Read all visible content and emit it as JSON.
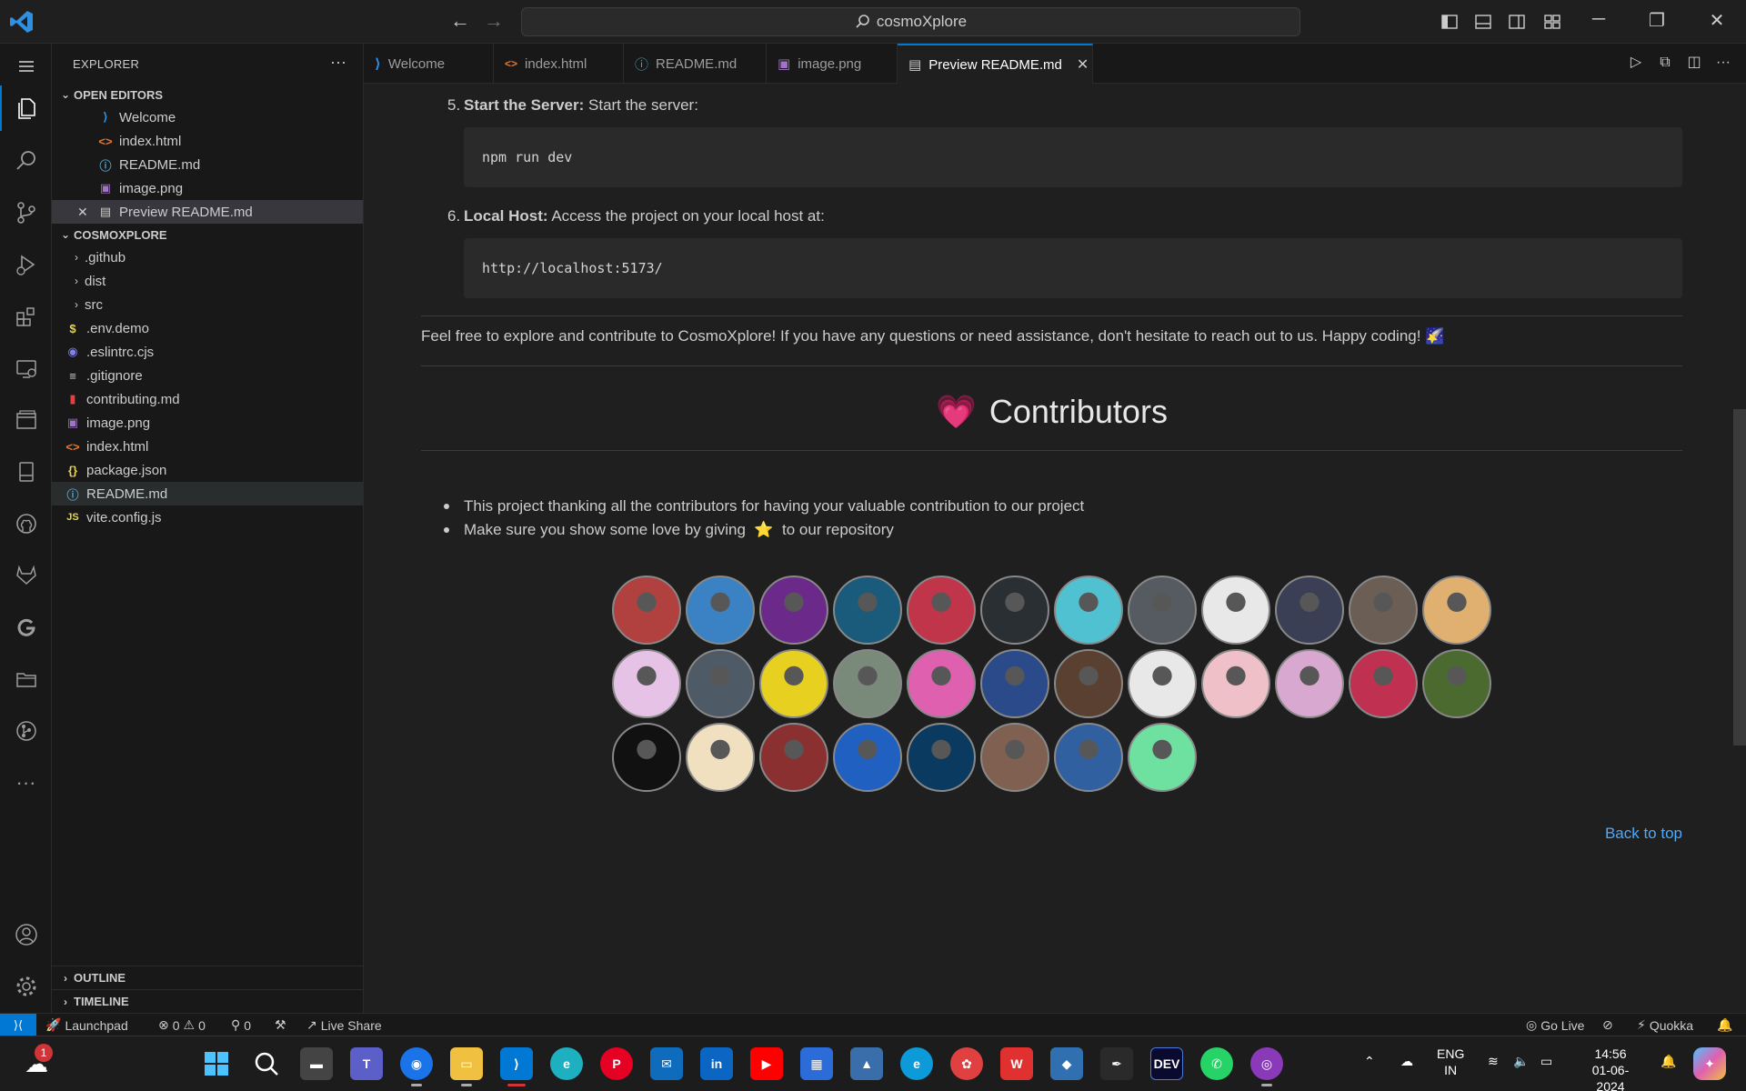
{
  "titlebar": {
    "search_text": "cosmoXplore"
  },
  "sidebar": {
    "title": "EXPLORER",
    "open_editors_title": "OPEN EDITORS",
    "open_editors": [
      "Welcome",
      "index.html",
      "README.md",
      "image.png",
      "Preview README.md"
    ],
    "project_title": "COSMOXPLORE",
    "files": [
      ".github",
      "dist",
      "src",
      ".env.demo",
      ".eslintrc.cjs",
      ".gitignore",
      "contributing.md",
      "image.png",
      "index.html",
      "package.json",
      "README.md",
      "vite.config.js"
    ],
    "outline_label": "OUTLINE",
    "timeline_label": "TIMELINE"
  },
  "tabs": [
    "Welcome",
    "index.html",
    "README.md",
    "image.png",
    "Preview README.md"
  ],
  "content": {
    "step5_num": "5.",
    "step5_bold": "Start the Server:",
    "step5_text": " Start the server:",
    "step5_code": "npm run dev",
    "step6_num": "6.",
    "step6_bold": "Local Host:",
    "step6_text": " Access the project on your local host at:",
    "step6_code": "http://localhost:5173/",
    "outro": "Feel free to explore and contribute to CosmoXplore! If you have any questions or need assistance, don't hesitate to reach out to us. Happy coding! 🌠",
    "contributors_heading": "Contributors",
    "heart": "💗",
    "bullet1": "This project thanking all the contributors for having your valuable contribution to our project",
    "bullet2_a": "Make sure you show some love by giving",
    "bullet2_star": "⭐",
    "bullet2_b": "to our repository",
    "back_to_top": "Back to top",
    "avatar_colors": [
      "#b0413e",
      "#3b82c4",
      "#6b2a8a",
      "#1a5a7a",
      "#c0354a",
      "#2a2f33",
      "#4fc1d0",
      "#555b60",
      "#e8e8e8",
      "#3a3f55",
      "#6b5e55",
      "#e0b070",
      "#e6c3e6",
      "#4e5a66",
      "#e8d020",
      "#7a8a7a",
      "#e060b0",
      "#2b4a8a",
      "#5a4030",
      "#e8e8e8",
      "#f0c0c8",
      "#d8a8d0",
      "#c03050",
      "#4a6a30",
      "#111111",
      "#f0e0c0",
      "#8a3030",
      "#2060c0",
      "#0a3a60",
      "#806050",
      "#3060a0",
      "#6ee0a0"
    ]
  },
  "statusbar": {
    "launchpad": "Launchpad",
    "errors": "0",
    "warnings": "0",
    "ports": "0",
    "live_share": "Live Share",
    "go_live": "Go Live",
    "quokka": "Quokka"
  },
  "taskbar": {
    "notif_badge": "1",
    "lang_top": "ENG",
    "lang_bottom": "IN",
    "time": "14:56",
    "date": "01-06-2024"
  }
}
